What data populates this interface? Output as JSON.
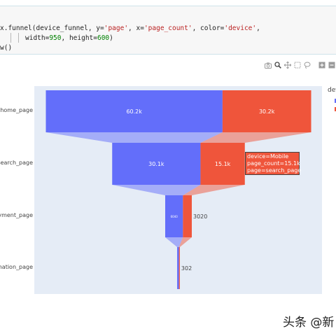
{
  "code": {
    "line1": {
      "p1": "x.funnel(device_funnel, y=",
      "s1": "'page'",
      "p2": ", x=",
      "s2": "'page_count'",
      "p3": ", color=",
      "s3": "'device'",
      "p4": ","
    },
    "line2": {
      "p1": "width=",
      "n1": "950",
      "p2": ", height=",
      "n2": "600",
      "p3": ")"
    },
    "line3": "w()"
  },
  "toolbar": [
    "camera-icon",
    "zoom-icon",
    "pan-icon",
    "box-select-icon",
    "lasso-icon",
    "zoom-in-icon",
    "zoom-out-icon"
  ],
  "legend": {
    "title": "devi",
    "colors": [
      "#636efa",
      "#ef553b"
    ]
  },
  "chart_data": {
    "type": "funnel",
    "categories": [
      "home_page",
      "search_page",
      "payment_page",
      "confirmation_page"
    ],
    "y_tick_labels": [
      "home_page",
      "search_page",
      "ayment_page",
      "rmation_page"
    ],
    "series": [
      {
        "color": "#636efa",
        "values": [
          60200,
          30100,
          6040,
          604
        ],
        "labels": [
          "60.2k",
          "30.1k",
          "6040",
          ""
        ]
      },
      {
        "color": "#ef553b",
        "values": [
          30200,
          15100,
          3020,
          302
        ],
        "labels": [
          "30.2k",
          "15.1k",
          "3020",
          "302"
        ]
      }
    ],
    "xlim": [
      -45200,
      45200
    ]
  },
  "tooltip": {
    "line1": "device=Mobile",
    "line2": "page_count=15.1k",
    "line3": "page=search_page"
  },
  "watermark": "头条 @新"
}
